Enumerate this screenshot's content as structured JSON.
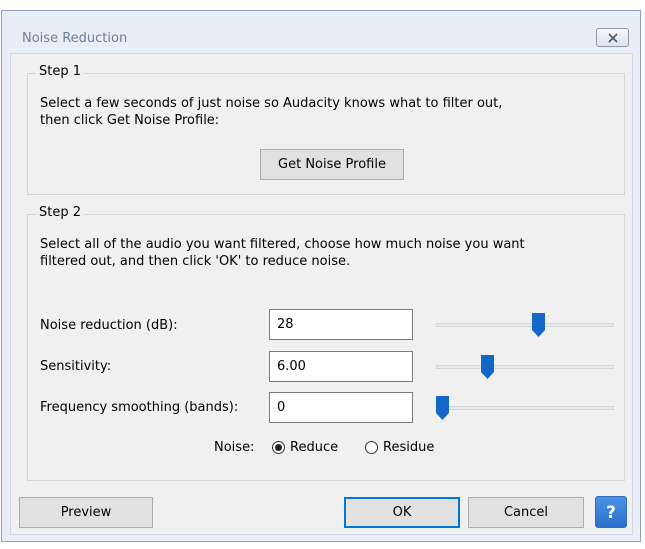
{
  "window": {
    "title": "Noise Reduction",
    "close_icon": "close-icon"
  },
  "step1": {
    "label": "Step 1",
    "description_line1": "Select a few seconds of just noise so Audacity knows what to filter out,",
    "description_line2": "then click Get Noise Profile:",
    "get_profile_button": "Get Noise Profile"
  },
  "step2": {
    "label": "Step 2",
    "description_line1": "Select all of the audio you want filtered, choose how much noise you want",
    "description_line2": "filtered out, and then click 'OK' to reduce noise.",
    "noise_reduction": {
      "label": "Noise reduction (dB):",
      "value": "28",
      "slider_fraction": 0.58
    },
    "sensitivity": {
      "label": "Sensitivity:",
      "value": "6.00",
      "slider_fraction": 0.27
    },
    "frequency_smoothing": {
      "label": "Frequency smoothing (bands):",
      "value": "0",
      "slider_fraction": 0.0
    },
    "noise_mode": {
      "label": "Noise:",
      "options": [
        "Reduce",
        "Residue"
      ],
      "selected": "Reduce"
    }
  },
  "buttons": {
    "preview": "Preview",
    "ok": "OK",
    "cancel": "Cancel",
    "help_icon": "help-icon"
  },
  "colors": {
    "slider_thumb": "#1466c8",
    "help_button": "#3a82dc",
    "title_text": "#6d7f96"
  }
}
